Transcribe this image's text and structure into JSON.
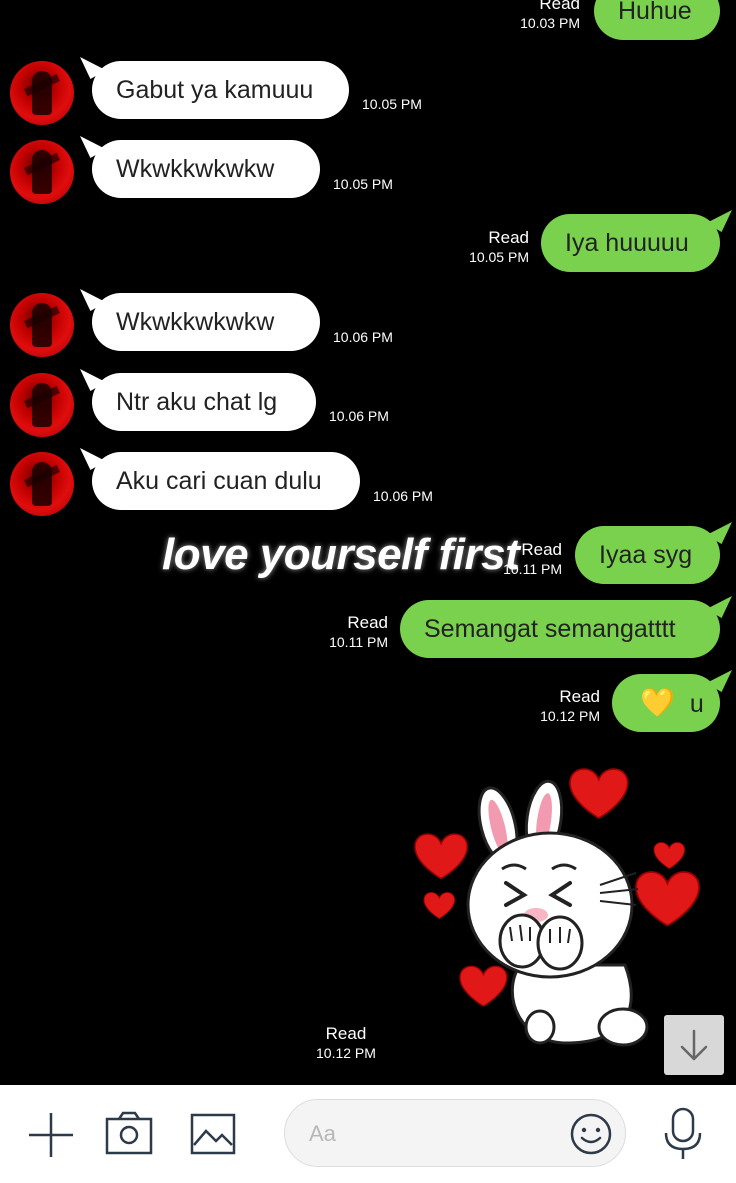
{
  "messages": [
    {
      "text": "Huhue",
      "read": "Read",
      "time": "10.03 PM"
    },
    {
      "text": "Gabut ya kamuuu",
      "time": "10.05 PM"
    },
    {
      "text": "Wkwkkwkwkw",
      "time": "10.05 PM"
    },
    {
      "text": "Iya huuuuu",
      "read": "Read",
      "time": "10.05 PM"
    },
    {
      "text": "Wkwkkwkwkw",
      "time": "10.06 PM"
    },
    {
      "text": "Ntr aku chat lg",
      "time": "10.06 PM"
    },
    {
      "text": "Aku cari cuan dulu",
      "time": "10.06 PM"
    },
    {
      "text": "Iyaa syg",
      "read": "Read",
      "time": "10.11 PM"
    },
    {
      "text": "Semangat semangatttt",
      "read": "Read",
      "time": "10.11 PM"
    },
    {
      "text": "u",
      "emoji": "💛",
      "read": "Read",
      "time": "10.12 PM"
    },
    {
      "sticker": "bunny-hearts-sticker",
      "read": "Read",
      "time": "10.12 PM"
    }
  ],
  "overlay_text": "love yourself first",
  "composer": {
    "placeholder": "Aa"
  },
  "icons": [
    "plus-icon",
    "camera-icon",
    "image-icon",
    "emoji-icon",
    "microphone-icon",
    "arrow-down-icon"
  ],
  "colors": {
    "outgoing_bubble": "#7ad14d",
    "incoming_bubble": "#ffffff",
    "background": "#000000"
  }
}
